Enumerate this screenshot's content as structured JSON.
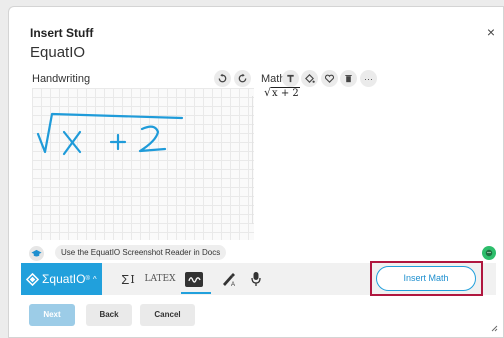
{
  "dialog": {
    "title": "Insert Stuff",
    "app_name": "EquatIO",
    "close_glyph": "×"
  },
  "handwriting": {
    "title": "Handwriting",
    "buttons": [
      "undo-icon",
      "redo-icon"
    ]
  },
  "math": {
    "title": "Math",
    "preview_radical": "√",
    "preview_expr": "x + 2",
    "buttons": [
      "text-format-icon",
      "fill-color-icon",
      "favorite-icon",
      "delete-icon",
      "more-icon"
    ],
    "more_glyph": "···"
  },
  "screenshot_reader": {
    "label": "Use the EquatIO Screenshot Reader in Docs"
  },
  "toolbar": {
    "logo_text": "ΣquatIO",
    "logo_mark": "®",
    "logo_caret": "^",
    "sigma_glyph": "Σ",
    "sigma_cursor": "I",
    "latex_label": "LATEX",
    "insert_label": "Insert Math"
  },
  "footer": {
    "next_label": "Next",
    "back_label": "Back",
    "cancel_label": "Cancel"
  },
  "colors": {
    "brand_blue": "#21a0dc",
    "highlight_red": "#b0173f",
    "status_green": "#2dbd6b"
  }
}
